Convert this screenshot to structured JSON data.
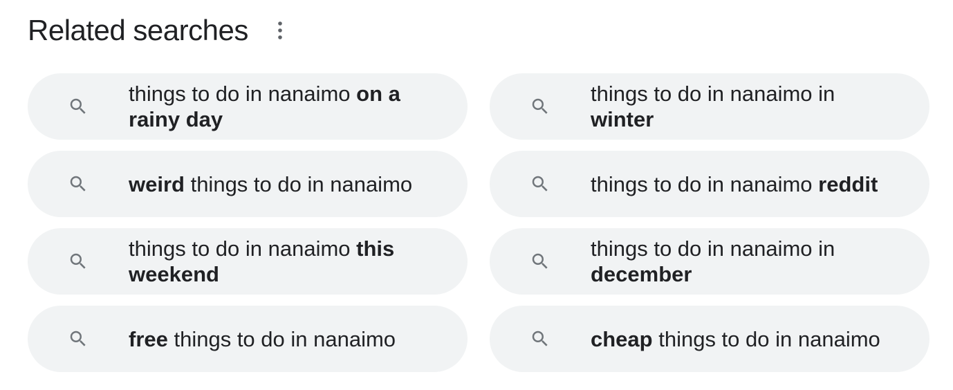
{
  "header": {
    "title": "Related searches",
    "more_icon": "more-vert-icon"
  },
  "related_searches": [
    {
      "prefix": "things to do in nanaimo ",
      "bold": "on a rainy day",
      "suffix": "",
      "icon": "search-icon"
    },
    {
      "prefix": "things to do in nanaimo in ",
      "bold": "winter",
      "suffix": "",
      "icon": "search-icon"
    },
    {
      "prefix": "",
      "bold": "weird",
      "suffix": " things to do in nanaimo",
      "icon": "search-icon"
    },
    {
      "prefix": "things to do in nanaimo ",
      "bold": "reddit",
      "suffix": "",
      "icon": "search-icon"
    },
    {
      "prefix": "things to do in nanaimo ",
      "bold": "this weekend",
      "suffix": "",
      "icon": "search-icon"
    },
    {
      "prefix": "things to do in nanaimo in ",
      "bold": "december",
      "suffix": "",
      "icon": "search-icon"
    },
    {
      "prefix": "",
      "bold": "free",
      "suffix": " things to do in nanaimo",
      "icon": "search-icon"
    },
    {
      "prefix": "",
      "bold": "cheap",
      "suffix": " things to do in nanaimo",
      "icon": "search-icon"
    }
  ],
  "colors": {
    "chip_background": "#f1f3f4",
    "text": "#202124",
    "icon": "#70757a"
  }
}
